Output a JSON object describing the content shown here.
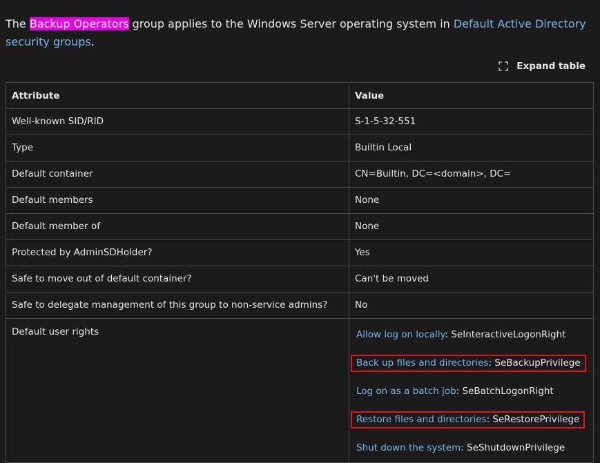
{
  "intro": {
    "prefix": "The ",
    "highlighted": "Backup Operators",
    "middle": " group applies to the Windows Server operating system in ",
    "link": "Default Active Directory security groups",
    "suffix": "."
  },
  "expand_table": {
    "label": "Expand table",
    "icon": "expand-icon"
  },
  "table": {
    "headers": [
      "Attribute",
      "Value"
    ],
    "rows": [
      {
        "attribute": "Well-known SID/RID",
        "value": "S-1-5-32-551"
      },
      {
        "attribute": "Type",
        "value": "Builtin Local"
      },
      {
        "attribute": "Default container",
        "value": "CN=Builtin, DC=<domain>, DC="
      },
      {
        "attribute": "Default members",
        "value": "None"
      },
      {
        "attribute": "Default member of",
        "value": "None"
      },
      {
        "attribute": "Protected by AdminSDHolder?",
        "value": "Yes"
      },
      {
        "attribute": "Safe to move out of default container?",
        "value": "Can't be moved"
      },
      {
        "attribute": "Safe to delegate management of this group to non-service admins?",
        "value": "No"
      }
    ],
    "rights_row": {
      "attribute": "Default user rights",
      "rights": [
        {
          "link": "Allow log on locally",
          "value": ": SeInteractiveLogonRight",
          "highlighted": false
        },
        {
          "link": "Back up files and directories",
          "value": ": SeBackupPrivilege",
          "highlighted": true
        },
        {
          "link": "Log on as a batch job",
          "value": ": SeBatchLogonRight",
          "highlighted": false
        },
        {
          "link": "Restore files and directories",
          "value": ": SeRestorePrivilege",
          "highlighted": true
        },
        {
          "link": "Shut down the system",
          "value": ": SeShutdownPrivilege",
          "highlighted": false
        }
      ]
    }
  },
  "colors": {
    "background": "#1b1b1b",
    "text": "#e6e6e6",
    "link": "#75b6e7",
    "highlight": "#e600e6",
    "annotation_box": "#e8101a",
    "border": "#4a4a4a"
  }
}
